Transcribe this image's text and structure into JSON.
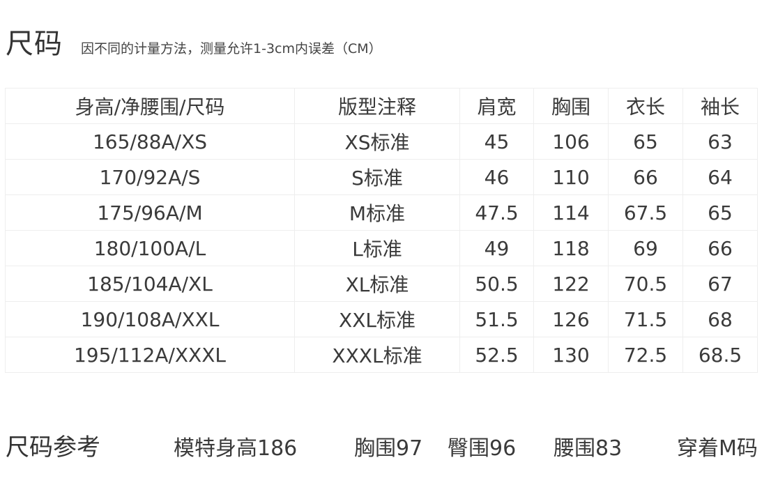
{
  "header": {
    "title": "尺码",
    "note": "因不同的计量方法，测量允许1-3cm内误差（CM）"
  },
  "table": {
    "columns": [
      "身高/净腰围/尺码",
      "版型注释",
      "肩宽",
      "胸围",
      "衣长",
      "袖长"
    ],
    "rows": [
      [
        "165/88A/XS",
        "XS标准",
        "45",
        "106",
        "65",
        "63"
      ],
      [
        "170/92A/S",
        "S标准",
        "46",
        "110",
        "66",
        "64"
      ],
      [
        "175/96A/M",
        "M标准",
        "47.5",
        "114",
        "67.5",
        "65"
      ],
      [
        "180/100A/L",
        "L标准",
        "49",
        "118",
        "69",
        "66"
      ],
      [
        "185/104A/XL",
        "XL标准",
        "50.5",
        "122",
        "70.5",
        "67"
      ],
      [
        "190/108A/XXL",
        "XXL标准",
        "51.5",
        "126",
        "71.5",
        "68"
      ],
      [
        "195/112A/XXXL",
        "XXXL标准",
        "52.5",
        "130",
        "72.5",
        "68.5"
      ]
    ]
  },
  "reference": {
    "title": "尺码参考",
    "height": "模特身高186",
    "chest": "胸围97",
    "hip": "臀围96",
    "waist": "腰围83",
    "wearing": "穿着M码"
  }
}
